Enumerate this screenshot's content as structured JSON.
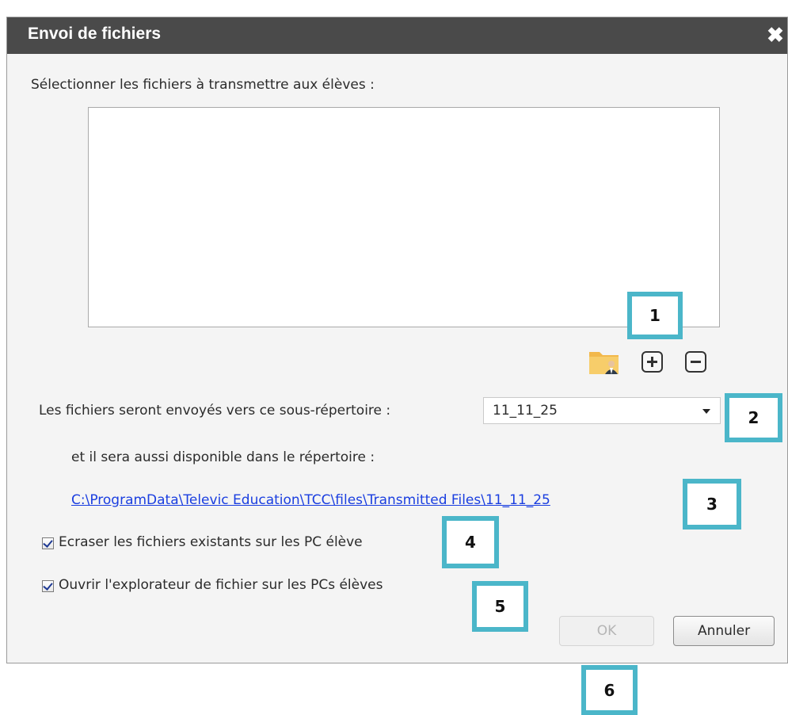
{
  "dialog": {
    "title": "Envoi de fichiers",
    "close_label": "✖",
    "instruction": "Sélectionner les fichiers à transmettre aux élèves :",
    "subdir_label": "Les fichiers seront envoyés vers ce sous-répertoire :",
    "subdir_value": "11_11_25",
    "repository_label": "et il sera aussi disponible dans le répertoire :",
    "path_link": "C:\\ProgramData\\Televic Education\\TCC\\files\\Transmitted Files\\11_11_25",
    "checkbox_overwrite": "Ecraser les fichiers existants sur les PC élève",
    "checkbox_overwrite_checked": true,
    "checkbox_explorer": "Ouvrir l'explorateur de fichier sur les PCs élèves",
    "checkbox_explorer_checked": true,
    "ok_label": "OK",
    "ok_enabled": false,
    "cancel_label": "Annuler"
  },
  "icons": {
    "folder": "folder-user-icon",
    "add": "plus-icon",
    "remove": "minus-icon",
    "close": "close-icon",
    "dropdown": "chevron-down-icon"
  },
  "callouts": [
    "1",
    "2",
    "3",
    "4",
    "5",
    "6"
  ],
  "colors": {
    "titlebar": "#4a4a4a",
    "callout_border": "#4bb6c9",
    "link": "#1a3ee0"
  }
}
